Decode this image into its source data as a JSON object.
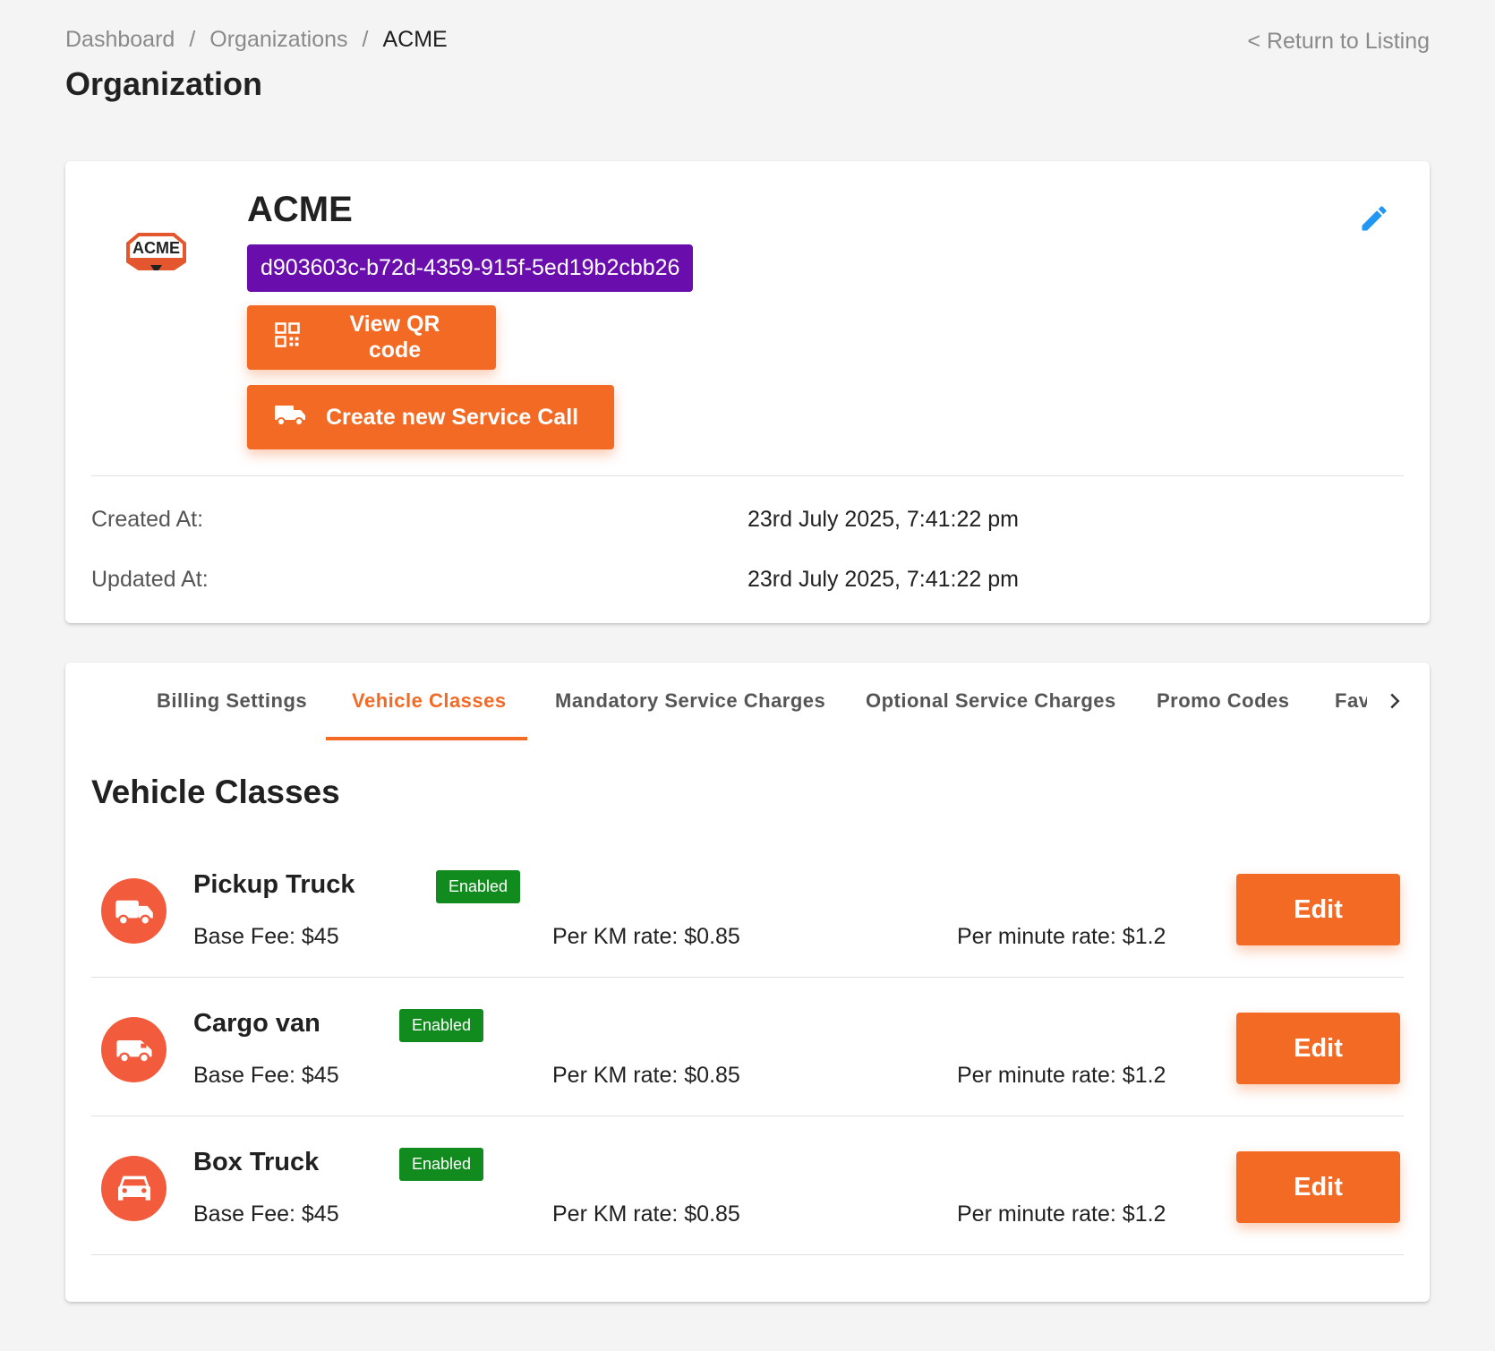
{
  "header": {
    "breadcrumb": [
      {
        "label": "Dashboard"
      },
      {
        "label": "Organizations"
      },
      {
        "label": "ACME"
      }
    ],
    "separator": "/",
    "return_link": "< Return to Listing",
    "page_title": "Organization"
  },
  "organization": {
    "logo_text": "ACME",
    "name": "ACME",
    "id": "d903603c-b72d-4359-915f-5ed19b2cbb26",
    "id_badge_color": "#6a0dad",
    "buttons": {
      "qr": "View QR code",
      "service_call": "Create new Service Call"
    },
    "meta": {
      "created_label": "Created At:",
      "created_value": "23rd July 2025, 7:41:22 pm",
      "updated_label": "Updated At:",
      "updated_value": "23rd July 2025, 7:41:22 pm"
    }
  },
  "tabs": [
    {
      "label": "Billing Settings",
      "active": false
    },
    {
      "label": "Vehicle Classes",
      "active": true
    },
    {
      "label": "Mandatory Service Charges",
      "active": false
    },
    {
      "label": "Optional Service Charges",
      "active": false
    },
    {
      "label": "Promo Codes",
      "active": false
    },
    {
      "label": "Fav",
      "active": false
    }
  ],
  "section": {
    "title": "Vehicle Classes"
  },
  "vehicle_classes": [
    {
      "name": "Pickup Truck",
      "status": "Enabled",
      "base_fee": "Base Fee: $45",
      "per_km": "Per KM rate: $0.85",
      "per_minute": "Per minute rate: $1.2",
      "icon": "truck-icon",
      "edit_label": "Edit"
    },
    {
      "name": "Cargo van",
      "status": "Enabled",
      "base_fee": "Base Fee: $45",
      "per_km": "Per KM rate: $0.85",
      "per_minute": "Per minute rate: $1.2",
      "icon": "van-icon",
      "edit_label": "Edit"
    },
    {
      "name": "Box Truck",
      "status": "Enabled",
      "base_fee": "Base Fee: $45",
      "per_km": "Per KM rate: $0.85",
      "per_minute": "Per minute rate: $1.2",
      "icon": "car-icon",
      "edit_label": "Edit"
    }
  ],
  "colors": {
    "accent": "#f26a24",
    "icon_bg": "#f25c3d",
    "badge_green": "#118a1e",
    "edit_icon": "#2196f3"
  }
}
